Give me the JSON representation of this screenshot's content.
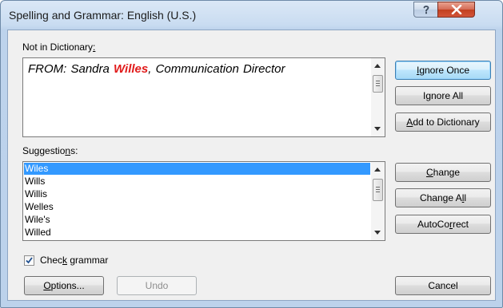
{
  "window": {
    "title": "Spelling and Grammar: English (U.S.)"
  },
  "not_in_dictionary": {
    "label_pre": "Not in Dictionary",
    "label_key": ":",
    "sentence_before": "FROM: Sandra ",
    "error_word": "Willes",
    "sentence_after": ", Communication Director"
  },
  "suggestions": {
    "label_pre": "Suggestio",
    "label_key": "n",
    "label_post": "s:",
    "items": [
      "Wiles",
      "Wills",
      "Willis",
      "Welles",
      "Wile's",
      "Willed"
    ],
    "selected_index": 0
  },
  "buttons": {
    "ignore_once": {
      "key": "I",
      "rest": "gnore Once"
    },
    "ignore_all": {
      "pre": "I",
      "key": "g",
      "rest": "nore All"
    },
    "add_to_dictionary": {
      "key": "A",
      "rest": "dd to Dictionary"
    },
    "change": {
      "key": "C",
      "rest": "hange"
    },
    "change_all": {
      "pre": "Change A",
      "key": "l",
      "rest": "l"
    },
    "autocorrect": {
      "pre": "AutoCo",
      "key": "r",
      "rest": "rect"
    },
    "options": {
      "key": "O",
      "rest": "ptions..."
    },
    "undo": "Undo",
    "cancel": "Cancel"
  },
  "check_grammar": {
    "pre": "Chec",
    "key": "k",
    "rest": " grammar",
    "checked": true
  },
  "icons": {
    "help": "help-icon",
    "close": "close-icon",
    "check": "checkmark-icon"
  },
  "colors": {
    "error_word": "#e11b1b",
    "selection": "#3399ff",
    "title_bar": "#c9dcf1",
    "close_button": "#c2401f"
  }
}
